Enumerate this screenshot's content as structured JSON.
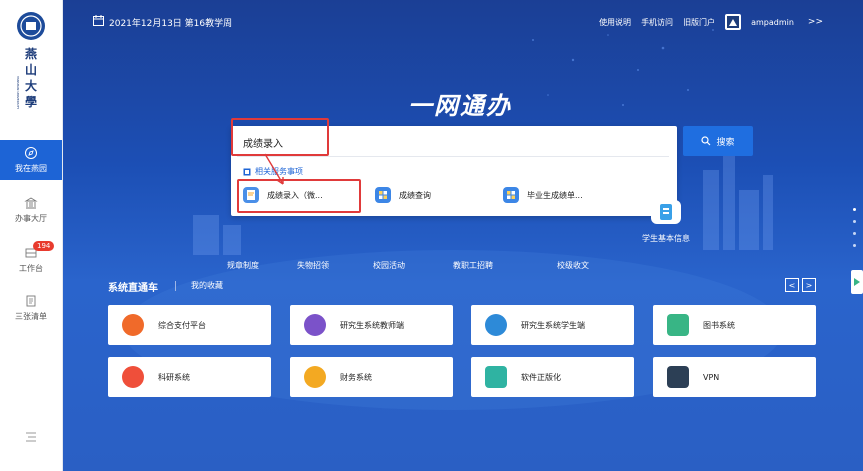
{
  "sidebar": {
    "logo_alt": "燕山大学",
    "items": [
      {
        "label": "我在燕园",
        "icon": "compass-icon",
        "active": true
      },
      {
        "label": "办事大厅",
        "icon": "bank-icon",
        "active": false
      },
      {
        "label": "工作台",
        "icon": "desk-icon",
        "active": false,
        "badge": "194"
      },
      {
        "label": "三张清单",
        "icon": "list-doc-icon",
        "active": false
      }
    ],
    "bottom_icon": "menu-icon"
  },
  "topbar": {
    "date": "2021年12月13日  第16教学周",
    "links": [
      "使用说明",
      "手机访问",
      "旧版门户"
    ],
    "username": "ampadmin",
    "more": ">>"
  },
  "brand": "一网通办",
  "search": {
    "value": "成绩录入",
    "button_label": "搜索",
    "related_title": "相关服务事项",
    "related_items": [
      {
        "label": "成绩录入（微...",
        "icon": "document-edit-icon"
      },
      {
        "label": "成绩查询",
        "icon": "grid-app-icon"
      },
      {
        "label": "毕业生成绩单...",
        "icon": "grid-app-icon"
      }
    ]
  },
  "quick_links": [
    "规章制度",
    "失物招领",
    "校园活动",
    "教职工招聘",
    "校级收文",
    "学生基本信息"
  ],
  "section": {
    "title": "系统直通车",
    "favorites": "我的收藏",
    "prev": "<",
    "next": ">"
  },
  "systems": [
    {
      "label": "综合支付平台",
      "color": "#f06a2a"
    },
    {
      "label": "研究生系统教师端",
      "color": "#7b52c9"
    },
    {
      "label": "研究生系统学生端",
      "color": "#2d8ad8"
    },
    {
      "label": "图书系统",
      "color": "#38b585"
    },
    {
      "label": "科研系统",
      "color": "#ef4f3a"
    },
    {
      "label": "财务系统",
      "color": "#f3a922"
    },
    {
      "label": "软件正版化",
      "color": "#2fb3a2"
    },
    {
      "label": "VPN",
      "color": "#2c3f55"
    }
  ],
  "colors": {
    "accent": "#1d64d6",
    "highlight": "#e03a3a",
    "badge": "#e83b2e"
  }
}
